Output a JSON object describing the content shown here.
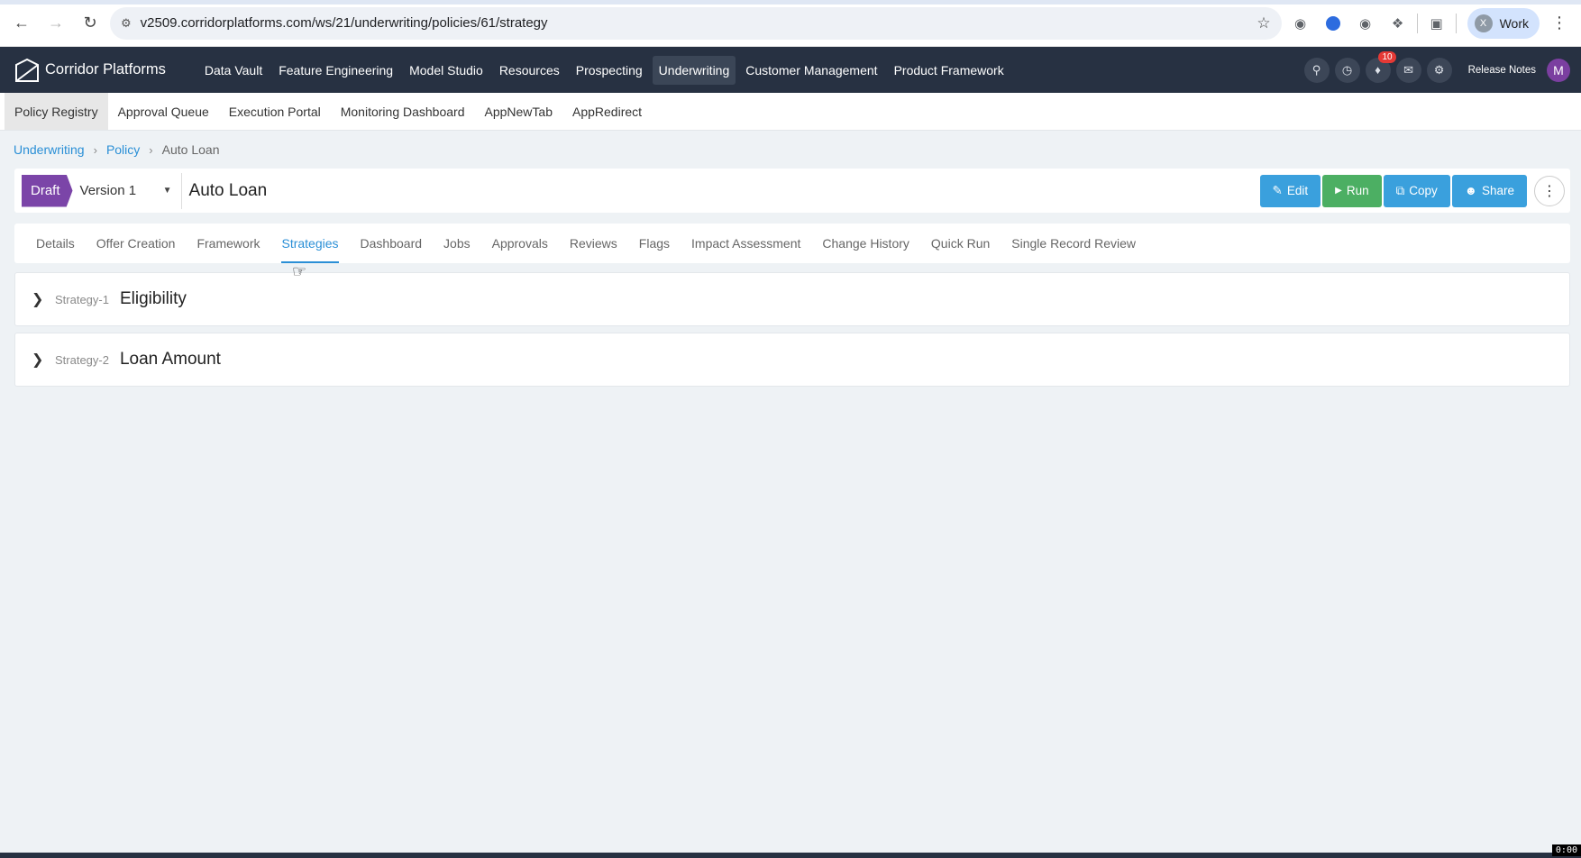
{
  "browser": {
    "url": "v2509.corridorplatforms.com/ws/21/underwriting/policies/61/strategy",
    "profile_initial": "X",
    "profile_label": "Work"
  },
  "app": {
    "brand": "Corridor Platforms",
    "main_menu": [
      {
        "label": "Data Vault"
      },
      {
        "label": "Feature Engineering"
      },
      {
        "label": "Model Studio"
      },
      {
        "label": "Resources"
      },
      {
        "label": "Prospecting"
      },
      {
        "label": "Underwriting"
      },
      {
        "label": "Customer Management"
      },
      {
        "label": "Product Framework"
      }
    ],
    "active_menu": "Underwriting",
    "notification_count": "10",
    "release_notes": "Release Notes",
    "avatar_initial": "M"
  },
  "sub_nav": [
    {
      "label": "Policy Registry"
    },
    {
      "label": "Approval Queue"
    },
    {
      "label": "Execution Portal"
    },
    {
      "label": "Monitoring Dashboard"
    },
    {
      "label": "AppNewTab"
    },
    {
      "label": "AppRedirect"
    }
  ],
  "breadcrumb": {
    "items": [
      "Underwriting",
      "Policy"
    ],
    "current": "Auto Loan"
  },
  "policy": {
    "status": "Draft",
    "version": "Version 1",
    "title": "Auto Loan",
    "actions": {
      "edit": "Edit",
      "run": "Run",
      "copy": "Copy",
      "share": "Share"
    }
  },
  "tabs": [
    {
      "label": "Details"
    },
    {
      "label": "Offer Creation"
    },
    {
      "label": "Framework"
    },
    {
      "label": "Strategies"
    },
    {
      "label": "Dashboard"
    },
    {
      "label": "Jobs"
    },
    {
      "label": "Approvals"
    },
    {
      "label": "Reviews"
    },
    {
      "label": "Flags"
    },
    {
      "label": "Impact Assessment"
    },
    {
      "label": "Change History"
    },
    {
      "label": "Quick Run"
    },
    {
      "label": "Single Record Review"
    }
  ],
  "active_tab": "Strategies",
  "strategies": [
    {
      "code": "Strategy-1",
      "name": "Eligibility"
    },
    {
      "code": "Strategy-2",
      "name": "Loan Amount"
    }
  ],
  "recording_timer": "0:00",
  "colors": {
    "nav_bg": "#273142",
    "accent": "#2a8fd6",
    "draft": "#7b45a8",
    "run": "#4caf63"
  }
}
